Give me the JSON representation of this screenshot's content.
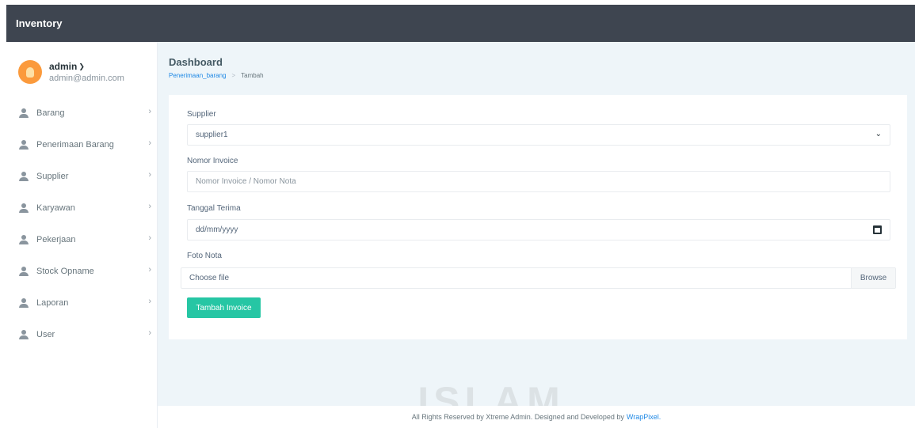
{
  "topbar": {
    "brand": "Inventory"
  },
  "profile": {
    "name": "admin",
    "email": "admin@admin.com"
  },
  "sidebar": {
    "items": [
      {
        "label": "Barang"
      },
      {
        "label": "Penerimaan Barang"
      },
      {
        "label": "Supplier"
      },
      {
        "label": "Karyawan"
      },
      {
        "label": "Pekerjaan"
      },
      {
        "label": "Stock Opname"
      },
      {
        "label": "Laporan"
      },
      {
        "label": "User"
      }
    ]
  },
  "page": {
    "title": "Dashboard",
    "breadcrumb": {
      "link": "Penerimaan_barang",
      "separator": ">",
      "current": "Tambah"
    }
  },
  "form": {
    "supplier_label": "Supplier",
    "supplier_value": "supplier1",
    "invoice_label": "Nomor Invoice",
    "invoice_placeholder": "Nomor Invoice / Nomor Nota",
    "date_label": "Tanggal Terima",
    "date_placeholder": "dd/mm/yyyy",
    "photo_label": "Foto Nota",
    "file_text": "Choose file",
    "browse_label": "Browse",
    "submit_label": "Tambah Invoice"
  },
  "watermark": {
    "text": "ISLAM"
  },
  "footer": {
    "text": "All Rights Reserved by Xtreme Admin. Designed and Developed by",
    "link": "WrapPixel."
  },
  "colors": {
    "topbar": "#3e4550",
    "accent": "#26c6a4",
    "link": "#1e88e5",
    "background": "#eef5f9"
  }
}
